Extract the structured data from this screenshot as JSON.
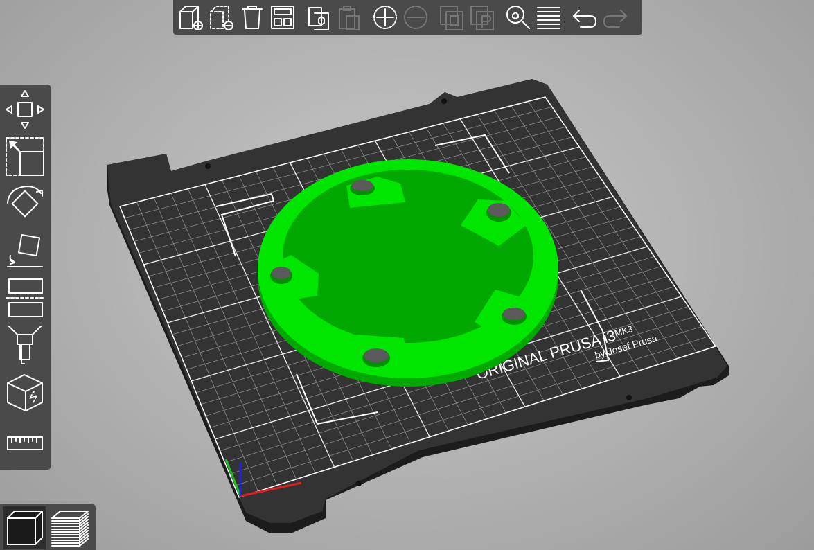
{
  "app": "PrusaSlicer 3D view",
  "top_toolbar": {
    "items": [
      {
        "icon": "add-object-icon",
        "enabled": true
      },
      {
        "icon": "delete-object-icon",
        "enabled": true
      },
      {
        "icon": "delete-all-icon",
        "enabled": true
      },
      {
        "icon": "arrange-icon",
        "enabled": true
      },
      {
        "icon": "copy-icon",
        "enabled": true
      },
      {
        "icon": "paste-icon",
        "enabled": false
      },
      {
        "icon": "add-instance-icon",
        "enabled": true
      },
      {
        "icon": "remove-instance-icon",
        "enabled": false
      },
      {
        "icon": "split-to-objects-icon",
        "enabled": false
      },
      {
        "icon": "split-to-parts-icon",
        "enabled": false
      },
      {
        "icon": "search-icon",
        "enabled": true
      },
      {
        "icon": "layers-editing-icon",
        "enabled": true
      },
      {
        "icon": "undo-icon",
        "enabled": true
      },
      {
        "icon": "redo-icon",
        "enabled": false
      }
    ]
  },
  "left_toolbar": {
    "items": [
      "move-icon",
      "scale-icon",
      "rotate-icon",
      "place-on-face-icon",
      "cut-icon",
      "paint-supports-icon",
      "seam-painting-icon",
      "measure-icon"
    ]
  },
  "view_tabs": {
    "items": [
      {
        "icon": "3d-view-icon",
        "active": true
      },
      {
        "icon": "preview-icon",
        "active": false
      }
    ]
  },
  "bed": {
    "brand": "ORIGINAL PRUSA i3",
    "model": "MK3",
    "byline": "by Josef Prusa"
  },
  "colors": {
    "background": "#b0b0b0",
    "toolbar": "#4a4a4a",
    "bed_plate": "#2f2f2f",
    "grid": "#ffffff",
    "model": "#00ee00",
    "axis_x": "#e02020",
    "axis_y": "#20c020",
    "axis_z": "#2020e0"
  }
}
